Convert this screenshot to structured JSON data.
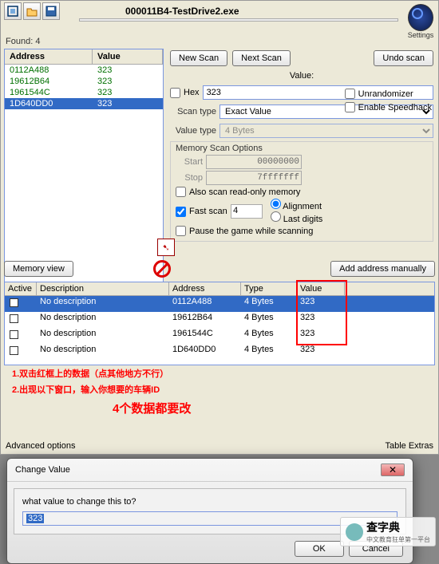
{
  "app": {
    "exe": "000011B4-TestDrive2.exe",
    "logo_text": "Settings"
  },
  "found": {
    "label": "Found:",
    "count": 4
  },
  "scanlist": {
    "head_addr": "Address",
    "head_val": "Value",
    "rows": [
      {
        "addr": "0112A488",
        "val": "323",
        "sel": false
      },
      {
        "addr": "19612B64",
        "val": "323",
        "sel": false
      },
      {
        "addr": "1961544C",
        "val": "323",
        "sel": false
      },
      {
        "addr": "1D640DD0",
        "val": "323",
        "sel": true
      }
    ]
  },
  "buttons": {
    "new_scan": "New Scan",
    "next_scan": "Next Scan",
    "undo": "Undo scan",
    "memview": "Memory view",
    "addmanual": "Add address manually",
    "ok": "OK",
    "cancel": "Cancel"
  },
  "fields": {
    "value_label": "Value:",
    "hex_label": "Hex",
    "value": "323",
    "scantype_label": "Scan type",
    "scantype": "Exact Value",
    "valuetype_label": "Value type",
    "valuetype": "4 Bytes"
  },
  "memopts": {
    "title": "Memory Scan Options",
    "start_lbl": "Start",
    "start": "00000000",
    "stop_lbl": "Stop",
    "stop": "7fffffff",
    "readonly": "Also scan read-only memory",
    "fast": "Fast scan",
    "fast_val": "4",
    "align": "Alignment",
    "last": "Last digits",
    "pause": "Pause the game while scanning"
  },
  "side": {
    "unr": "Unrandomizer",
    "sh": "Enable Speedhack"
  },
  "addrlist": {
    "head": {
      "active": "Active",
      "desc": "Description",
      "addr": "Address",
      "type": "Type",
      "val": "Value"
    },
    "rows": [
      {
        "desc": "No description",
        "addr": "0112A488",
        "type": "4 Bytes",
        "val": "323",
        "sel": true
      },
      {
        "desc": "No description",
        "addr": "19612B64",
        "type": "4 Bytes",
        "val": "323",
        "sel": false
      },
      {
        "desc": "No description",
        "addr": "1961544C",
        "type": "4 Bytes",
        "val": "323",
        "sel": false
      },
      {
        "desc": "No description",
        "addr": "1D640DD0",
        "type": "4 Bytes",
        "val": "323",
        "sel": false
      }
    ]
  },
  "anno": {
    "l1": "1.双击红框上的数据（点其他地方不行）",
    "l2": "2.出现以下窗口，输入你想要的车辆ID",
    "l3": "4个数据都要改"
  },
  "bottom": {
    "adv": "Advanced options",
    "extras": "Table Extras"
  },
  "dialog": {
    "title": "Change Value",
    "prompt": "what value to change this to?",
    "value": "323"
  },
  "watermark": {
    "text": "查字典",
    "sub": "中文教育狂单第一平台"
  }
}
